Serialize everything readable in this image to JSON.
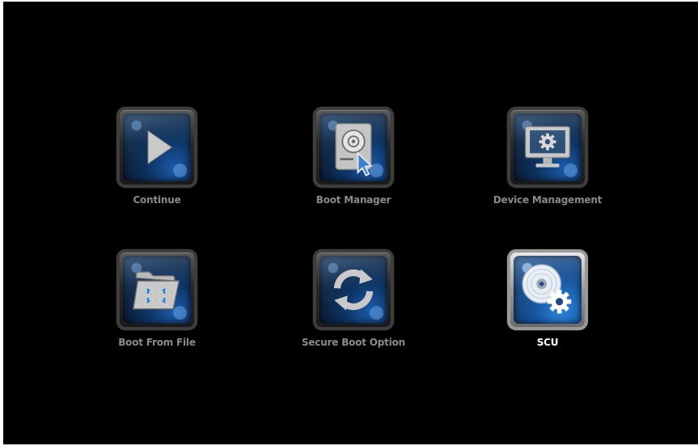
{
  "menu": {
    "selected": "SCU",
    "items": [
      {
        "id": "continue",
        "label": "Continue",
        "icon": "play-icon"
      },
      {
        "id": "boot-manager",
        "label": "Boot Manager",
        "icon": "boot-disk-cursor-icon"
      },
      {
        "id": "device-management",
        "label": "Device Management",
        "icon": "monitor-gear-icon"
      },
      {
        "id": "boot-from-file",
        "label": "Boot From File",
        "icon": "folder-compress-icon"
      },
      {
        "id": "secure-boot-option",
        "label": "Secure Boot Option",
        "icon": "refresh-arrows-icon"
      },
      {
        "id": "scu",
        "label": "SCU",
        "icon": "disc-gear-icon"
      }
    ]
  },
  "colors": {
    "background": "#000000",
    "label": "#8a8a8a",
    "label_selected": "#ffffff",
    "tile_blue": "#17304f",
    "icon_gray": "#c8c8c8"
  }
}
